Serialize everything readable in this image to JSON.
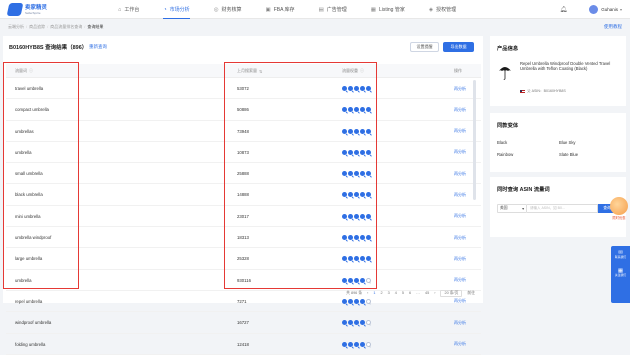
{
  "app": {
    "logo_cn": "卖家精灵",
    "logo_en": "SellerSprite"
  },
  "nav": [
    {
      "icon": "home-icon",
      "glyph": "⌂",
      "label": "工作台",
      "active": false
    },
    {
      "icon": "chart-icon",
      "glyph": "◔",
      "label": "市场分析",
      "active": true
    },
    {
      "icon": "money-icon",
      "glyph": "◎",
      "label": "财务核算",
      "active": false
    },
    {
      "icon": "box-icon",
      "glyph": "▣",
      "label": "FBA 库存",
      "active": false
    },
    {
      "icon": "ad-icon",
      "glyph": "▤",
      "label": "广告管理",
      "active": false
    },
    {
      "icon": "listing-icon",
      "glyph": "▦",
      "label": "Listing 管家",
      "active": false
    },
    {
      "icon": "shield-icon",
      "glyph": "◈",
      "label": "授权管理",
      "active": false
    }
  ],
  "user": {
    "name": "Guhanis"
  },
  "breadcrumb": [
    "云端分析",
    "商品追踪",
    "商品流量排名查询",
    "查询结果"
  ],
  "usage_link": "使用教程",
  "panel": {
    "title": "B0160HYB8S 查询结果（896）",
    "back_link": "重新查询",
    "btn_secondary": "设置提醒",
    "btn_primary": "导出数据"
  },
  "table": {
    "headers": [
      "流量词",
      "上月搜索量",
      "流量权重",
      "操作"
    ],
    "rows": [
      {
        "keyword": "travel umbrella",
        "volume": "53072",
        "weight": 5,
        "action": "再分析"
      },
      {
        "keyword": "compact umbrella",
        "volume": "50886",
        "weight": 5,
        "action": "再分析"
      },
      {
        "keyword": "umbrellas",
        "volume": "73948",
        "weight": 5,
        "action": "再分析"
      },
      {
        "keyword": "umbrella",
        "volume": "10873",
        "weight": 5,
        "action": "再分析"
      },
      {
        "keyword": "small umbrella",
        "volume": "25888",
        "weight": 5,
        "action": "再分析"
      },
      {
        "keyword": "black umbrella",
        "volume": "14888",
        "weight": 5,
        "action": "再分析"
      },
      {
        "keyword": "mini umbrella",
        "volume": "23017",
        "weight": 5,
        "action": "再分析"
      },
      {
        "keyword": "umbrella windproof",
        "volume": "18313",
        "weight": 5,
        "action": "再分析"
      },
      {
        "keyword": "large umbrella",
        "volume": "25328",
        "weight": 5,
        "action": "再分析"
      },
      {
        "keyword": "umbrella",
        "volume": "930116",
        "weight": 4,
        "action": "再分析"
      },
      {
        "keyword": "repel umbrella",
        "volume": "7271",
        "weight": 4,
        "action": "再分析"
      },
      {
        "keyword": "windproof umbrella",
        "volume": "16727",
        "weight": 4,
        "action": "再分析"
      },
      {
        "keyword": "folding umbrella",
        "volume": "12418",
        "weight": 4,
        "action": "再分析"
      }
    ]
  },
  "pager": {
    "total": "共 896 条",
    "pages": [
      "1",
      "2",
      "3",
      "4",
      "5",
      "6",
      "…",
      "45"
    ],
    "active_page": "1",
    "page_size": "20 条/页",
    "goto": "前往"
  },
  "product": {
    "card_title": "产品信息",
    "title": "Repel Umbrella Windproof Double Vented Travel Umbrella with Teflon Coating (Black)",
    "asin": "父 ASIN：B0160HYB8S"
  },
  "variants": {
    "card_title": "同款变体",
    "items": [
      "Black",
      "Blue Sky",
      "Rainbow",
      "Slate Blue"
    ]
  },
  "asin_query": {
    "card_title": "同时查询 ASIN 流量词",
    "market": "美国",
    "placeholder": "请输入 ASIN，如 B0...",
    "button": "查询"
  },
  "floating": {
    "promo": "限时优惠",
    "side": [
      {
        "icon": "chat-icon",
        "glyph": "✉",
        "label": "联系我们"
      },
      {
        "icon": "qr-icon",
        "glyph": "▦",
        "label": "关注我们"
      }
    ]
  }
}
